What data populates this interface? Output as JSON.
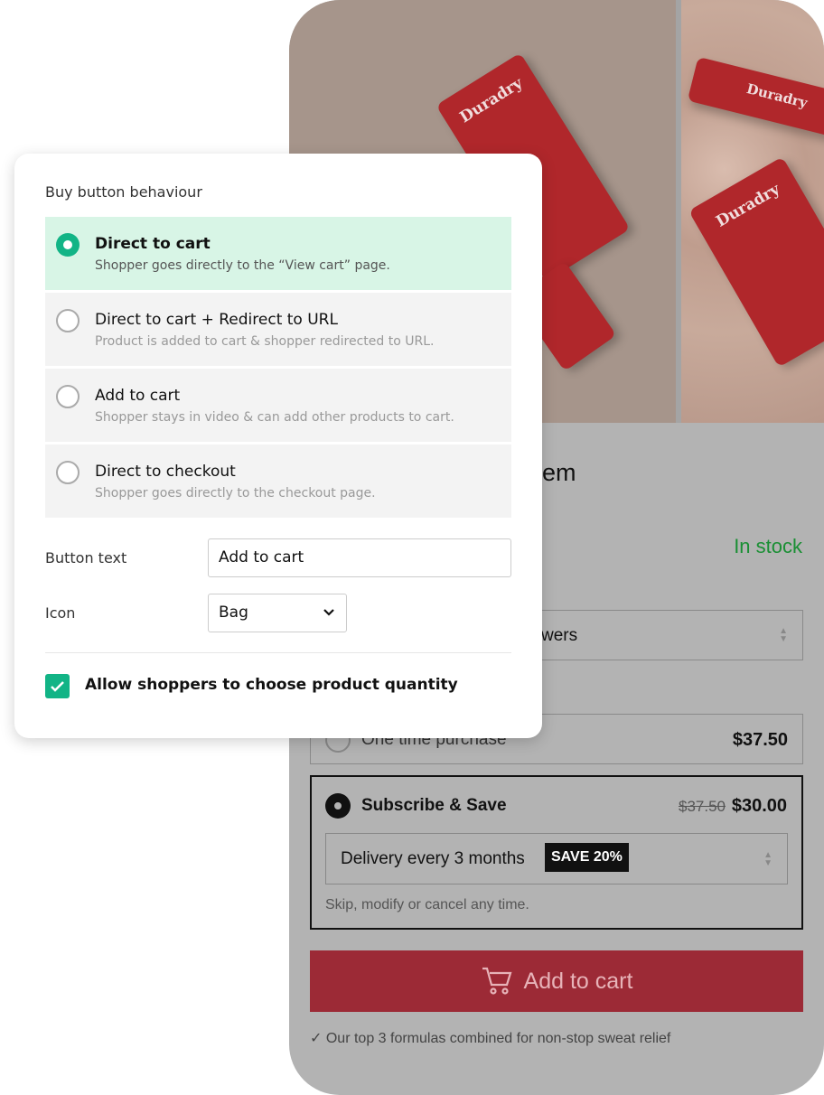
{
  "product": {
    "brand_on_tubes": "Duradry",
    "title_fragment": "em",
    "stock": "In stock",
    "variant_fragment": "wers",
    "one_time": {
      "label": "One time purchase",
      "price": "$37.50"
    },
    "subscribe": {
      "label": "Subscribe & Save",
      "old_price": "$37.50",
      "price": "$30.00",
      "delivery": "Delivery every 3 months",
      "badge": "SAVE 20%",
      "note": "Skip, modify or cancel any time."
    },
    "add_to_cart": "Add to cart",
    "footer": "Our top 3 formulas combined for non-stop sweat relief",
    "colors": {
      "stock": "#1a8f34",
      "cart_button": "#9c2a36"
    }
  },
  "modal": {
    "title": "Buy button behaviour",
    "options": [
      {
        "label": "Direct to cart",
        "desc": "Shopper goes directly to the “View cart” page.",
        "selected": true
      },
      {
        "label": "Direct to cart + Redirect to URL",
        "desc": "Product is added to cart & shopper redirected to URL.",
        "selected": false
      },
      {
        "label": "Add to cart",
        "desc": "Shopper stays in video & can add other products to cart.",
        "selected": false
      },
      {
        "label": "Direct to checkout",
        "desc": "Shopper goes directly to the checkout page.",
        "selected": false
      }
    ],
    "button_text_label": "Button text",
    "button_text_value": "Add to cart",
    "icon_label": "Icon",
    "icon_value": "Bag",
    "quantity_label": "Allow shoppers to choose product quantity",
    "quantity_checked": true,
    "accent": "#12b486"
  }
}
